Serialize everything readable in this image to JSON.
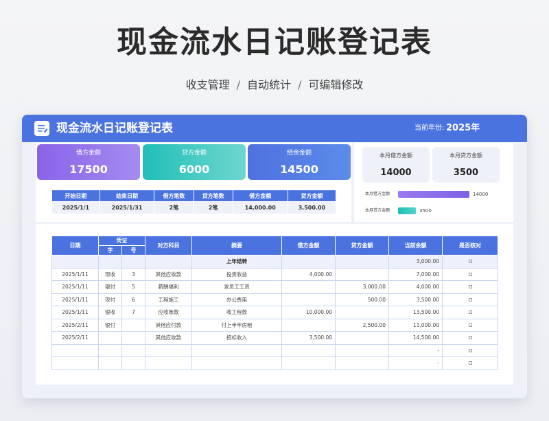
{
  "hero": {
    "title": "现金流水日记账登记表",
    "sub_1": "收支管理",
    "sub_2": "自动统计",
    "sub_3": "可编辑修改",
    "separator": "/"
  },
  "header": {
    "title": "现金流水日记账登记表",
    "year_label": "当前年份:",
    "year_value": "2025年",
    "accent": "#4a73e0"
  },
  "summary": {
    "debit_label": "借方金额",
    "debit_value": "17500",
    "credit_label": "贷方金额",
    "credit_value": "6000",
    "balance_label": "结余金额",
    "balance_value": "14500",
    "table": {
      "headers": [
        "开始日期",
        "结束日期",
        "借方笔数",
        "贷方笔数",
        "借方金额",
        "贷方金额"
      ],
      "values": [
        "2025/1/1",
        "2025/1/31",
        "2笔",
        "2笔",
        "14,000.00",
        "3,500.00"
      ]
    }
  },
  "monthly": {
    "debit_label": "本月借方金额",
    "debit_value": "14000",
    "credit_label": "本月贷方金额",
    "credit_value": "3500",
    "bars": [
      {
        "label": "本月借方金额",
        "value": 14000,
        "value_text": "14000",
        "color": "#8a6cf0"
      },
      {
        "label": "本月贷方金额",
        "value": 3500,
        "value_text": "3500",
        "color": "#1fbfb8"
      }
    ]
  },
  "ledger": {
    "h_date": "日期",
    "h_voucher": "凭证",
    "h_char": "字",
    "h_num": "号",
    "h_account": "对方科目",
    "h_summary": "摘要",
    "h_debit": "借方金额",
    "h_credit": "贷方金额",
    "h_balance": "当前余额",
    "h_checked": "是否核对",
    "rows": [
      {
        "date": "",
        "char": "",
        "num": "",
        "account": "",
        "summary": "上年结转",
        "debit": "",
        "credit": "",
        "balance": "3,000.00",
        "carry": true
      },
      {
        "date": "2025/1/11",
        "char": "现收",
        "num": "3",
        "account": "其他应收款",
        "summary": "投资收益",
        "debit": "4,000.00",
        "credit": "",
        "balance": "7,000.00"
      },
      {
        "date": "2025/1/11",
        "char": "银付",
        "num": "5",
        "account": "薪酬福利",
        "summary": "发员工工资",
        "debit": "",
        "credit": "3,000.00",
        "balance": "4,000.00"
      },
      {
        "date": "2025/1/11",
        "char": "现付",
        "num": "6",
        "account": "工程施工",
        "summary": "办公费用",
        "debit": "",
        "credit": "500.00",
        "balance": "3,500.00"
      },
      {
        "date": "2025/1/11",
        "char": "银收",
        "num": "7",
        "account": "应收账款",
        "summary": "收工程款",
        "debit": "10,000.00",
        "credit": "",
        "balance": "13,500.00"
      },
      {
        "date": "2025/2/11",
        "char": "银付",
        "num": "",
        "account": "其他应付款",
        "summary": "付上半年房租",
        "debit": "",
        "credit": "2,500.00",
        "balance": "11,000.00"
      },
      {
        "date": "2025/2/11",
        "char": "",
        "num": "",
        "account": "其他应收款",
        "summary": "招标收入",
        "debit": "3,500.00",
        "credit": "",
        "balance": "14,500.00"
      },
      {
        "date": "",
        "char": "",
        "num": "",
        "account": "",
        "summary": "",
        "debit": "",
        "credit": "",
        "balance": "-"
      },
      {
        "date": "",
        "char": "",
        "num": "",
        "account": "",
        "summary": "",
        "debit": "",
        "credit": "",
        "balance": "-"
      }
    ]
  }
}
